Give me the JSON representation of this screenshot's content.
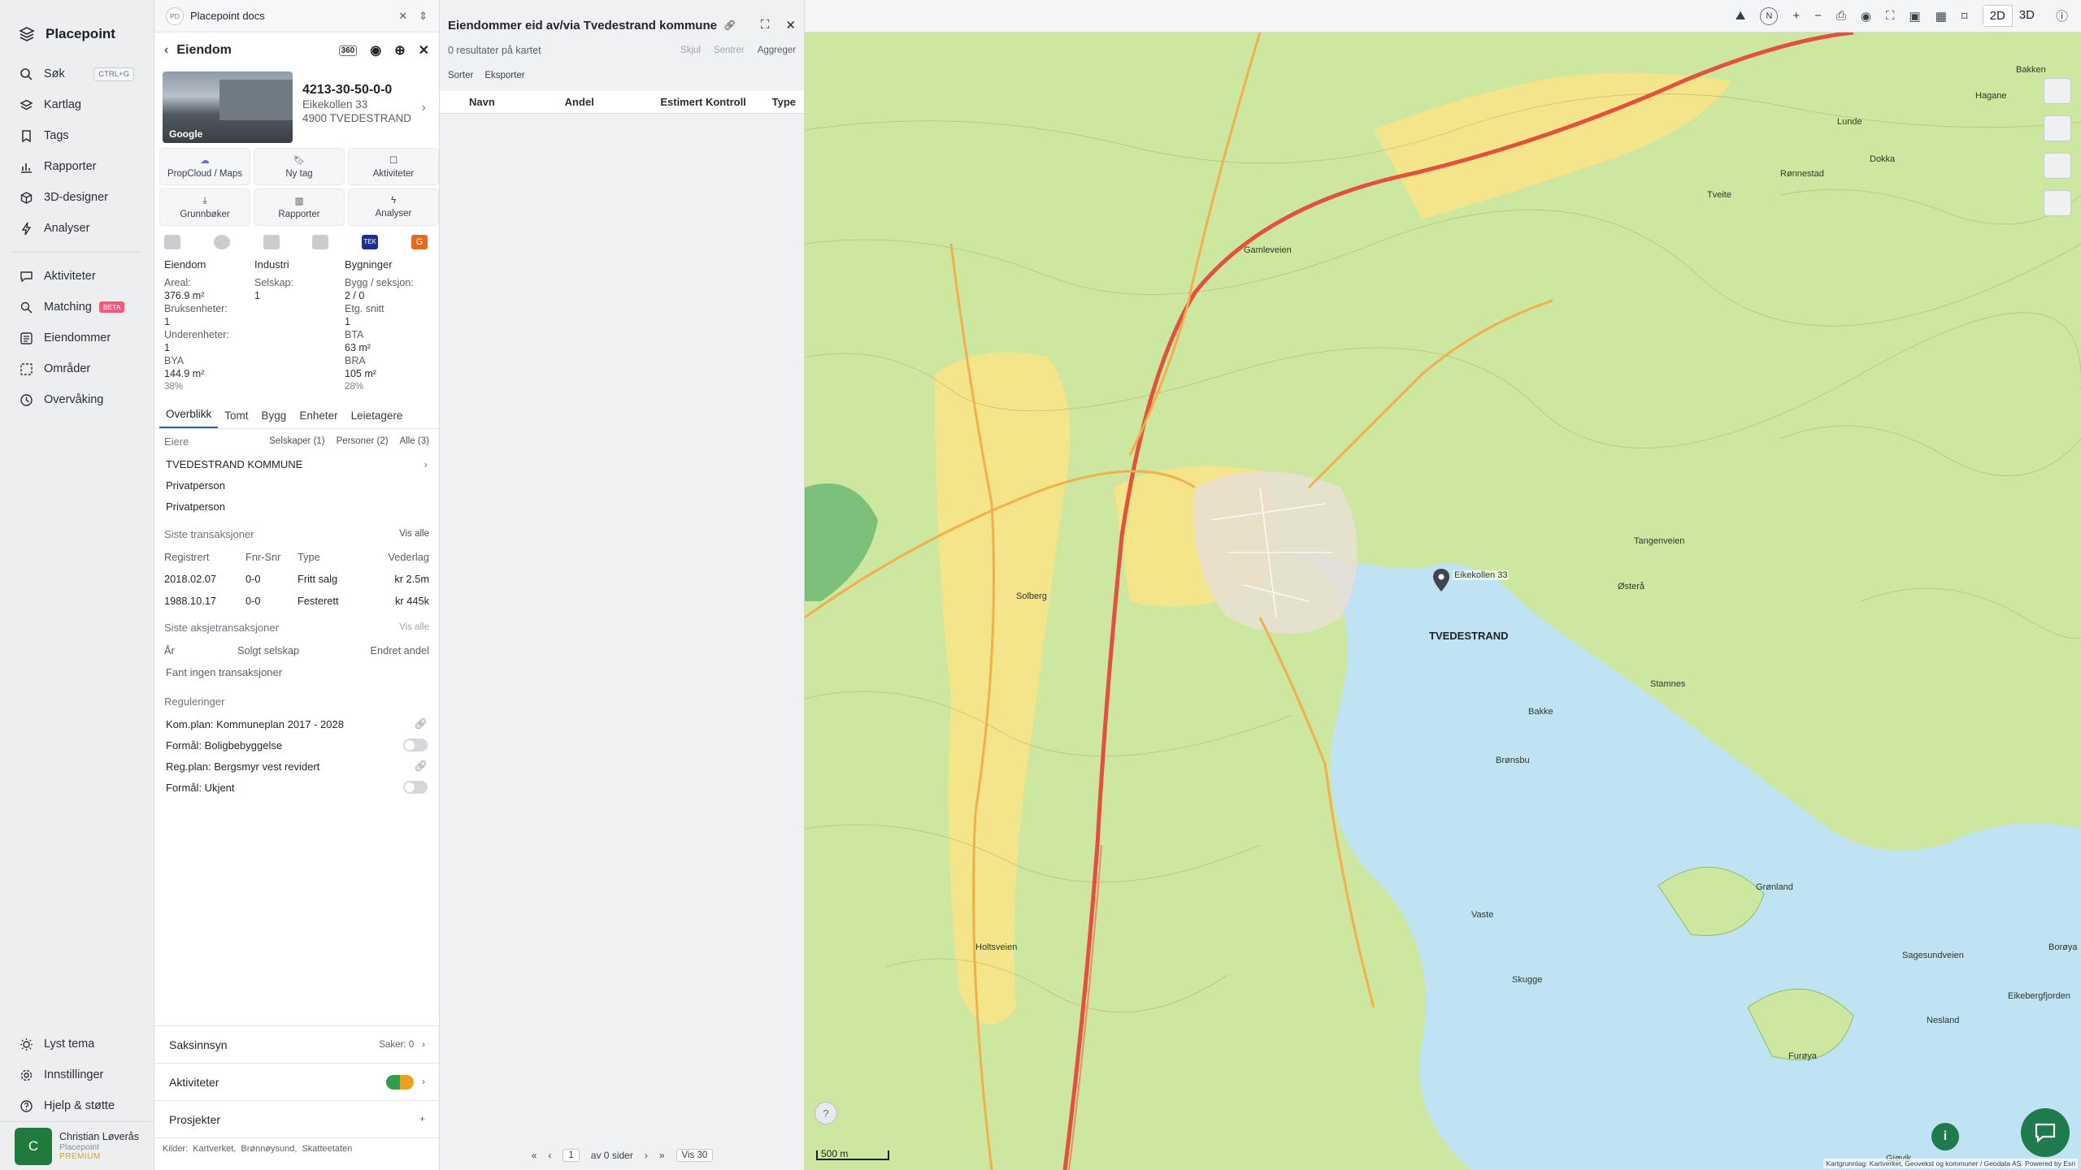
{
  "app": {
    "name": "Placepoint"
  },
  "sidebar": {
    "items": [
      {
        "label": "Søk",
        "shortcut": "CTRL+G",
        "icon": "search-icon"
      },
      {
        "label": "Kartlag",
        "icon": "layers-icon"
      },
      {
        "label": "Tags",
        "icon": "bookmark-icon"
      },
      {
        "label": "Rapporter",
        "icon": "chart-icon"
      },
      {
        "label": "3D-designer",
        "icon": "cube-icon"
      },
      {
        "label": "Analyser",
        "icon": "bolt-icon"
      }
    ],
    "items2": [
      {
        "label": "Aktiviteter",
        "icon": "chat-icon"
      },
      {
        "label": "Matching",
        "badge": "BETA",
        "icon": "match-icon"
      },
      {
        "label": "Eiendommer",
        "icon": "list-icon"
      },
      {
        "label": "Områder",
        "icon": "area-icon"
      },
      {
        "label": "Overvåking",
        "icon": "watch-icon"
      }
    ],
    "bottom": [
      {
        "label": "Lyst tema",
        "icon": "sun-icon"
      },
      {
        "label": "Innstillinger",
        "icon": "gear-icon"
      },
      {
        "label": "Hjelp & støtte",
        "icon": "help-icon"
      }
    ],
    "user": {
      "initial": "C",
      "name": "Christian Løverås",
      "company": "Placepoint",
      "plan": "PREMIUM"
    }
  },
  "doc": {
    "badge": "PD",
    "title": "Placepoint docs"
  },
  "property": {
    "header": "Eiendom",
    "gid": "4213-30-50-0-0",
    "street": "Eikekollen 33",
    "postal": "4900 TVEDESTRAND",
    "photo_label": "Google",
    "actions": [
      "PropCloud / Maps",
      "Ny tag",
      "Aktiviteter",
      "Grunnbøker",
      "Rapporter",
      "Analyser"
    ],
    "facts": {
      "col1_title": "Eiendom",
      "col2_title": "Industri",
      "col3_title": "Bygninger",
      "areal_label": "Areal:",
      "areal_value": "376.9 m²",
      "selskap_label": "Selskap:",
      "selskap_value": "1",
      "bygg_label": "Bygg / seksjon:",
      "bygg_value": "2 / 0",
      "bruk_label": "Bruksenheter:",
      "bruk_value": "1",
      "etg_label": "Etg. snitt",
      "etg_value": "1",
      "under_label": "Underenheter:",
      "under_value": "1",
      "bta_label": "BTA",
      "bta_value": "63 m²",
      "bya_label": "BYA",
      "bya_value": "144.9 m²",
      "bya_pct": "38%",
      "bra_label": "BRA",
      "bra_value": "105 m²",
      "bra_pct": "28%"
    },
    "tabs": [
      "Overblikk",
      "Tomt",
      "Bygg",
      "Enheter",
      "Leietagere"
    ],
    "owners": {
      "title": "Eiere",
      "filters": [
        "Selskaper (1)",
        "Personer (2)",
        "Alle (3)"
      ],
      "list": [
        "TVEDESTRAND KOMMUNE",
        "Privatperson",
        "Privatperson"
      ]
    },
    "transactions": {
      "title": "Siste transaksjoner",
      "see_all": "Vis alle",
      "headers": [
        "Registrert",
        "Fnr-Snr",
        "Type",
        "Vederlag"
      ],
      "rows": [
        [
          "2018.02.07",
          "0-0",
          "Fritt salg",
          "kr 2.5m"
        ],
        [
          "1988.10.17",
          "0-0",
          "Festerett",
          "kr 445k"
        ]
      ]
    },
    "share_tx": {
      "title": "Siste aksjetransaksjoner",
      "see_all": "Vis alle",
      "headers": [
        "År",
        "Solgt selskap",
        "Endret andel"
      ],
      "empty": "Fant ingen transaksjoner"
    },
    "regs": {
      "title": "Reguleringer",
      "rows": [
        "Kom.plan: Kommuneplan 2017 - 2028",
        "Formål: Boligbebyggelse",
        "Reg.plan: Bergsmyr vest revidert",
        "Formål: Ukjent"
      ]
    },
    "bottom": [
      {
        "label": "Saksinnsyn",
        "info": "Saker: 0"
      },
      {
        "label": "Aktiviteter"
      },
      {
        "label": "Prosjekter"
      }
    ],
    "sources": [
      "Kilder:",
      "Kartverket,",
      "Brønnøysund,",
      "Skatteetaten"
    ]
  },
  "list_panel": {
    "title": "Eiendommer eid av/via Tvedestrand kommune",
    "count": "0 resultater på kartet",
    "actions": [
      "Skjul",
      "Sentrer",
      "Aggreger"
    ],
    "tools": [
      "Sorter",
      "Eksporter"
    ],
    "columns": [
      "Navn",
      "Andel",
      "Estimert Kontroll",
      "Type"
    ],
    "pager": {
      "page": "1",
      "of": "av 0 sider",
      "per": "Vis 30"
    }
  },
  "map": {
    "mode_2d": "2D",
    "mode_3d": "3D",
    "compass": "N",
    "scale": "500 m",
    "attribution": "Kartgrunnlag: Kartverket, Geovekst og kommuner / Geodata AS. Powered by Esri",
    "town": "TVEDESTRAND",
    "marker_label": "Eikekollen 33",
    "labels": [
      "Hagane",
      "Bakken",
      "Lunde",
      "Dokka",
      "Tveite",
      "Rønnestad",
      "Eikebergfjorden",
      "Grønland",
      "Sagesundveien",
      "Furøya",
      "Solberg",
      "Holtsveien",
      "Gamleveien",
      "Tangenveien",
      "Østerå",
      "Stamnes",
      "Bakke",
      "Brønsbu",
      "Vaste",
      "Skugge",
      "Nesland",
      "Gjøvik",
      "Borøya"
    ]
  },
  "colors": {
    "accent": "#1b5fc9",
    "green": "#1f7a4c",
    "map": "#cde6a0"
  }
}
